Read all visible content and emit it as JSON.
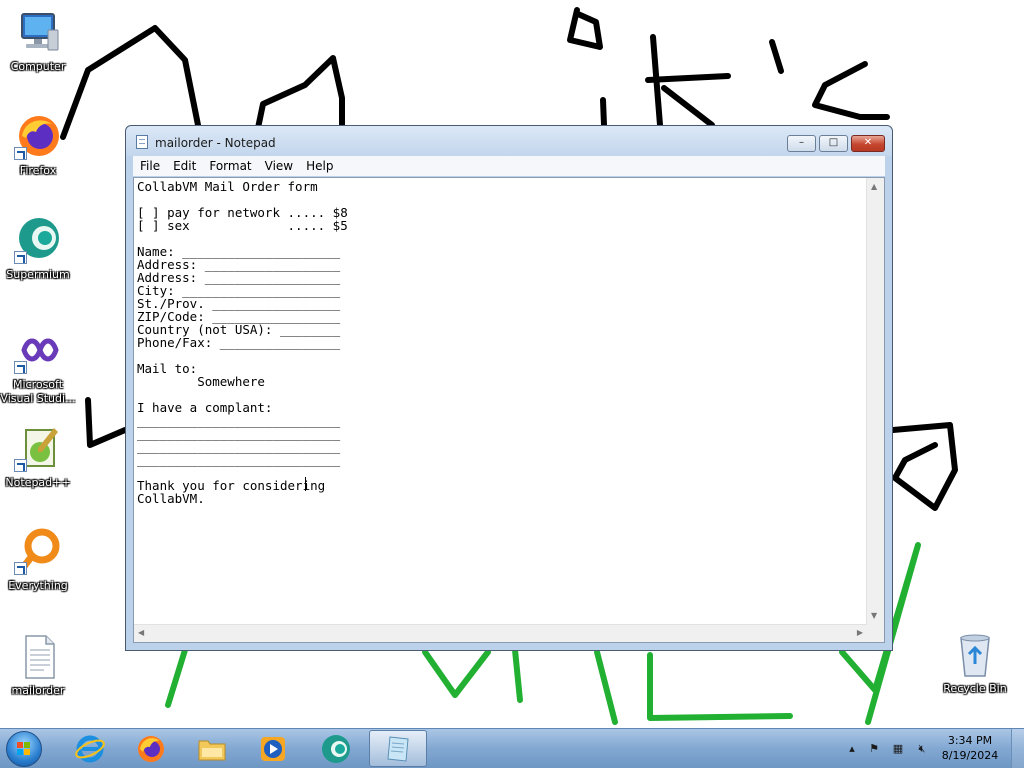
{
  "desktop": {
    "icons": [
      {
        "label": "Computer"
      },
      {
        "label": "Firefox"
      },
      {
        "label": "Supermium"
      },
      {
        "label": "Microsoft Visual Studi..."
      },
      {
        "label": "Notepad++"
      },
      {
        "label": "Everything"
      },
      {
        "label": "mailorder"
      },
      {
        "label": "Recycle Bin"
      }
    ]
  },
  "notepad": {
    "title": "mailorder - Notepad",
    "controls": {
      "minimize": "–",
      "maximize": "□",
      "close": "✕"
    },
    "menu": [
      "File",
      "Edit",
      "Format",
      "View",
      "Help"
    ],
    "content": "CollabVM Mail Order form\n\n[ ] pay for network ..... $8\n[ ] sex             ..... $5\n\nName: _____________________\nAddress: __________________\nAddress: __________________\nCity: _____________________\nSt./Prov. _________________\nZIP/Code: _________________\nCountry (not USA): ________\nPhone/Fax: ________________\n\nMail to:\n        Somewhere\n\nI have a complant:\n___________________________\n___________________________\n___________________________\n___________________________\n\nThank you for considering\nCollabVM."
  },
  "taskbar": {
    "pinned": [
      "Internet Explorer",
      "Firefox",
      "Windows Explorer",
      "Windows Media Player",
      "Supermium",
      "Notepad"
    ],
    "clock": {
      "time": "3:34 PM",
      "date": "8/19/2024"
    },
    "tray": [
      "show-hidden-icons",
      "action-center-flag",
      "network",
      "volume-muted"
    ]
  },
  "colors": {
    "doodle_black": "#000000",
    "doodle_green": "#22b033",
    "window_frame": "#bcd2ea",
    "taskbar": "#82a8d2"
  }
}
